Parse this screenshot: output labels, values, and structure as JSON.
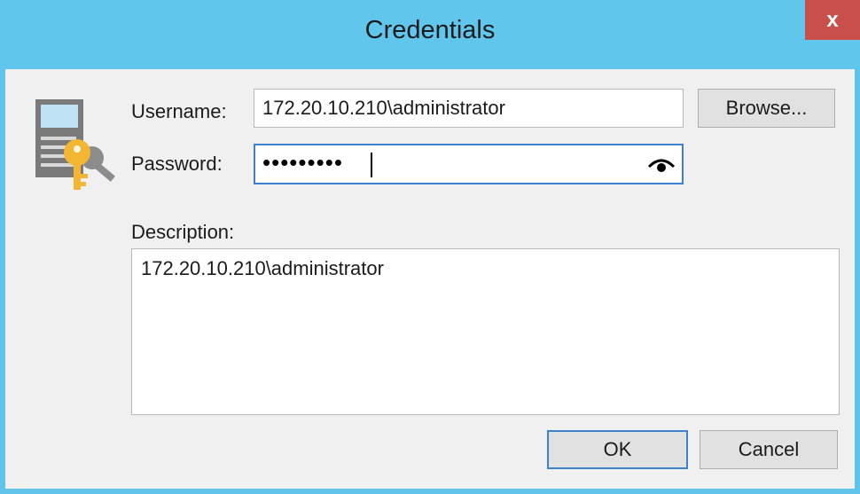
{
  "window": {
    "title": "Credentials",
    "close_label": "x"
  },
  "form": {
    "username_label": "Username:",
    "username_value": "172.20.10.210\\administrator",
    "password_label": "Password:",
    "password_mask": "•••••••••",
    "description_label": "Description:",
    "description_value": "172.20.10.210\\administrator"
  },
  "buttons": {
    "browse": "Browse...",
    "ok": "OK",
    "cancel": "Cancel"
  },
  "icons": {
    "credentials": "credentials-key-icon",
    "show_password": "eye-icon",
    "close": "close-icon"
  },
  "colors": {
    "titlebar": "#60c6ec",
    "close": "#c9504a",
    "focus_border": "#3c82cc"
  }
}
